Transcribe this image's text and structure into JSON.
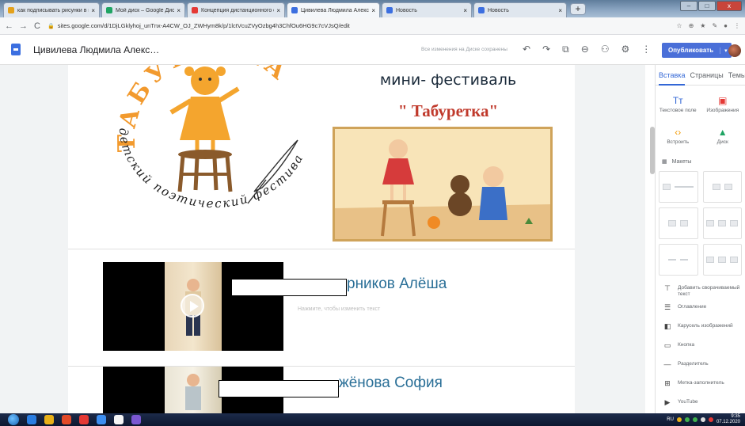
{
  "browser": {
    "tabs": [
      {
        "title": "как подписывать рисунки в вор",
        "color": "#e4a11b",
        "active": false
      },
      {
        "title": "Мой диск – Google Диск",
        "color": "#1fa463",
        "active": false
      },
      {
        "title": "Концепция дистанционного об",
        "color": "#e53935",
        "active": false
      },
      {
        "title": "Цивилева Людмила Александ",
        "color": "#3c6fe0",
        "active": true
      },
      {
        "title": "Новость",
        "color": "#3c6fe0",
        "active": false
      },
      {
        "title": "Новость",
        "color": "#3c6fe0",
        "active": false
      }
    ],
    "new_tab_label": "+",
    "close_glyph": "×",
    "window_controls": [
      "–",
      "□",
      "x"
    ],
    "nav": {
      "back": "←",
      "forward": "→",
      "reload": "C"
    },
    "url": "sites.google.com/d/1DjLGklyhoj_unTnx-A4CW_OJ_ZWHym8k/p/1lctVcuZVyOzbg4h3ChfOu6HG9c7cVJsQ/edit",
    "extension_icons": [
      "☆",
      "⊕",
      "★",
      "✎",
      "●",
      "⋮"
    ]
  },
  "editor": {
    "doc_title": "Цивилева Людмила Алекс…",
    "saved_status": "Все изменения на Диске сохранены",
    "tools": {
      "undo": "↶",
      "redo": "↷",
      "preview": "⧉",
      "link": "⊖",
      "share": "⚇",
      "settings": "⚙",
      "more": "⋮"
    },
    "publish_label": "Опубликовать",
    "publish_arrow": "▾"
  },
  "page": {
    "logo_arc_top": "ТАБУРЕТКА",
    "logo_arc_bottom": "детский поэтический фестиваль",
    "festival_line1": "мини- фестиваль",
    "festival_line2": "\" Табуретка\"",
    "entries": [
      {
        "name": "рников Алёша",
        "hint": "Нажмите, чтобы изменить текст"
      },
      {
        "name": "жёнова София",
        "hint": ""
      }
    ]
  },
  "panel": {
    "tabs": [
      "Вставка",
      "Страницы",
      "Темы"
    ],
    "insert_items": [
      {
        "icon": "Tт",
        "label": "Текстовое поле",
        "color": "#3367d6"
      },
      {
        "icon": "▣",
        "label": "Изображения",
        "color": "#e53935"
      },
      {
        "icon": "‹›",
        "label": "Встроить",
        "color": "#f29900"
      },
      {
        "icon": "▲",
        "label": "Диск",
        "color": "#1fa463"
      }
    ],
    "layouts_icon": "▦",
    "layouts_label": "Макеты",
    "components": [
      {
        "icon": "⊤",
        "label": "Добавить сворачиваемый текст"
      },
      {
        "icon": "☰",
        "label": "Оглавление"
      },
      {
        "icon": "◧",
        "label": "Карусель изображений"
      },
      {
        "icon": "▭",
        "label": "Кнопка"
      },
      {
        "icon": "—",
        "label": "Разделитель"
      },
      {
        "icon": "⊞",
        "label": "Метка-заполнитель"
      },
      {
        "icon": "▶",
        "label": "YouTube"
      }
    ]
  },
  "taskbar": {
    "apps": [
      "#2a7de1",
      "#e8b018",
      "#e24a28",
      "#e53935",
      "#3d8ef0",
      "#f5f5f5",
      "#7a57d1"
    ],
    "tray_lang": "RU",
    "time": "9:35",
    "date": "07.12.2020"
  }
}
